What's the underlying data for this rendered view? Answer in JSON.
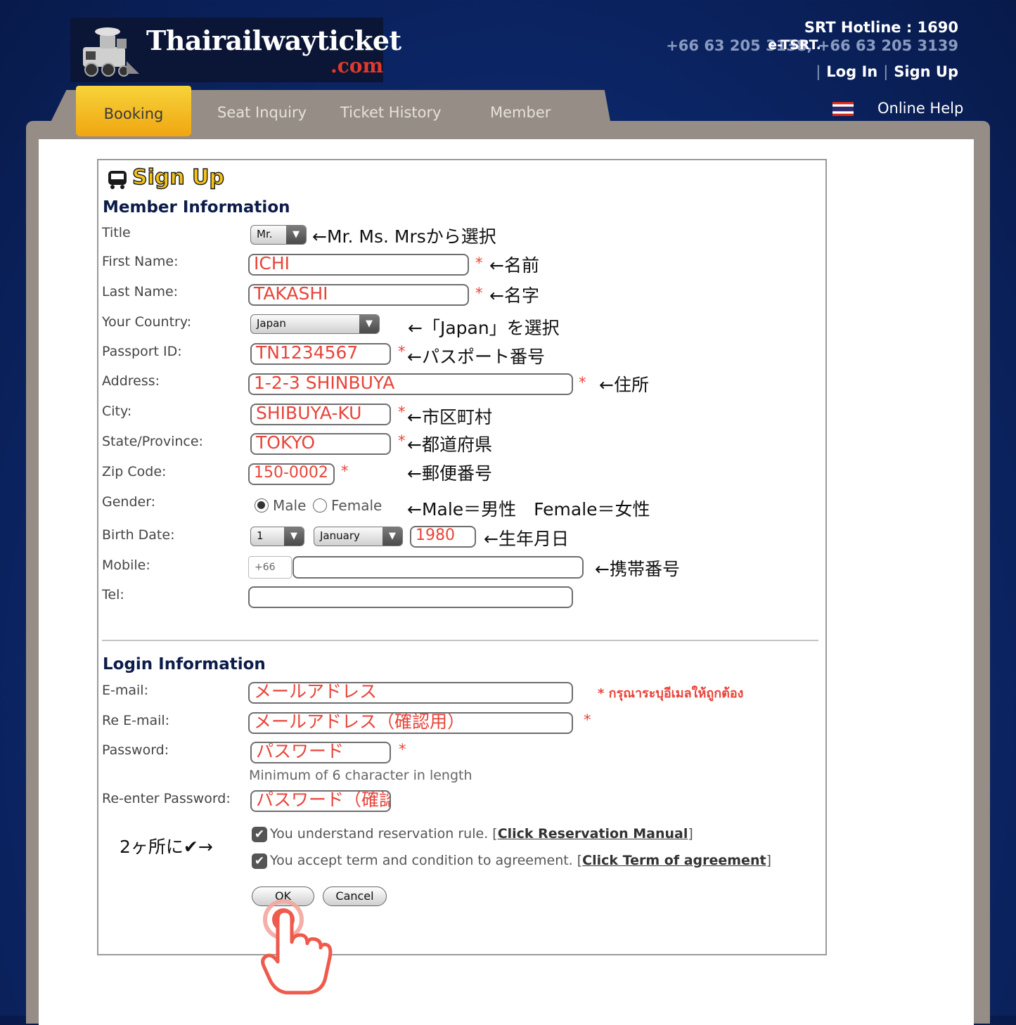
{
  "header": {
    "logo_main": "Thairailwayticket",
    "logo_suffix": ".com",
    "hotline": "SRT Hotline : 1690",
    "etsrt_label": "e-TSRT.",
    "etsrt_numbers": "+66 63 205 3138, +66 63 205 3139",
    "login": "Log In",
    "signup": "Sign Up"
  },
  "nav": {
    "tabs": [
      "Booking",
      "Seat Inquiry",
      "Ticket History",
      "Member"
    ],
    "active_tab": "Booking",
    "online_help": "Online Help"
  },
  "page": {
    "title": "Sign Up",
    "member_section": "Member Information",
    "login_section": "Login Information"
  },
  "member": {
    "title_label": "Title",
    "title_value": "Mr.",
    "first_name_label": "First Name:",
    "first_name_value": "ICHI",
    "last_name_label": "Last Name:",
    "last_name_value": "TAKASHI",
    "country_label": "Your Country:",
    "country_value": "Japan",
    "passport_label": "Passport ID:",
    "passport_value": "TN1234567",
    "address_label": "Address:",
    "address_value": "1-2-3 SHINBUYA",
    "city_label": "City:",
    "city_value": "SHIBUYA-KU",
    "state_label": "State/Province:",
    "state_value": "TOKYO",
    "zip_label": "Zip Code:",
    "zip_value": "150-0002",
    "gender_label": "Gender:",
    "gender_male": "Male",
    "gender_female": "Female",
    "gender_selected": "Male",
    "birth_label": "Birth Date:",
    "birth_day": "1",
    "birth_month": "January",
    "birth_year": "1980",
    "mobile_label": "Mobile:",
    "mobile_prefix": "+66",
    "mobile_value": "",
    "tel_label": "Tel:",
    "tel_value": ""
  },
  "login": {
    "email_label": "E-mail:",
    "email_value": "メールアドレス",
    "email_error": "* กรุณาระบุอีเมลให้ถูกต้อง",
    "re_email_label": "Re E-mail:",
    "re_email_value": "メールアドレス（確認用）",
    "password_label": "Password:",
    "password_value": "パスワード",
    "password_hint": "Minimum of 6 character in length",
    "re_password_label": "Re-enter Password:",
    "re_password_value": "パスワード（確認用）",
    "check1_text": "You understand reservation rule. [",
    "check1_link": "Click Reservation Manual",
    "check2_text": "You accept term and condition to agreement. [",
    "check2_link": "Click Term of agreement",
    "bracket_close": "]",
    "ok": "OK",
    "cancel": "Cancel"
  },
  "annotations": {
    "title": "←Mr. Ms. Mrsから選択",
    "first_name": "←名前",
    "last_name": "←名字",
    "country": "←「Japan」を選択",
    "passport": "←パスポート番号",
    "address": "←住所",
    "city": "←市区町村",
    "state": "←都道府県",
    "zip": "←郵便番号",
    "gender": "←Male＝男性　Female＝女性",
    "birth": "←生年月日",
    "mobile": "←携帯番号",
    "checkbox_note": "2ヶ所に✔→"
  },
  "colors": {
    "required": "#e8443a",
    "active_tab": "#f0b21a",
    "heading": "#0c1c4a",
    "annotation_arrow": "#1f7d6e"
  },
  "icons": [
    "train-logo-icon",
    "thai-flag-icon",
    "bus-icon",
    "dropdown-arrow-icon",
    "checkbox-check-icon",
    "pointing-hand-icon"
  ]
}
